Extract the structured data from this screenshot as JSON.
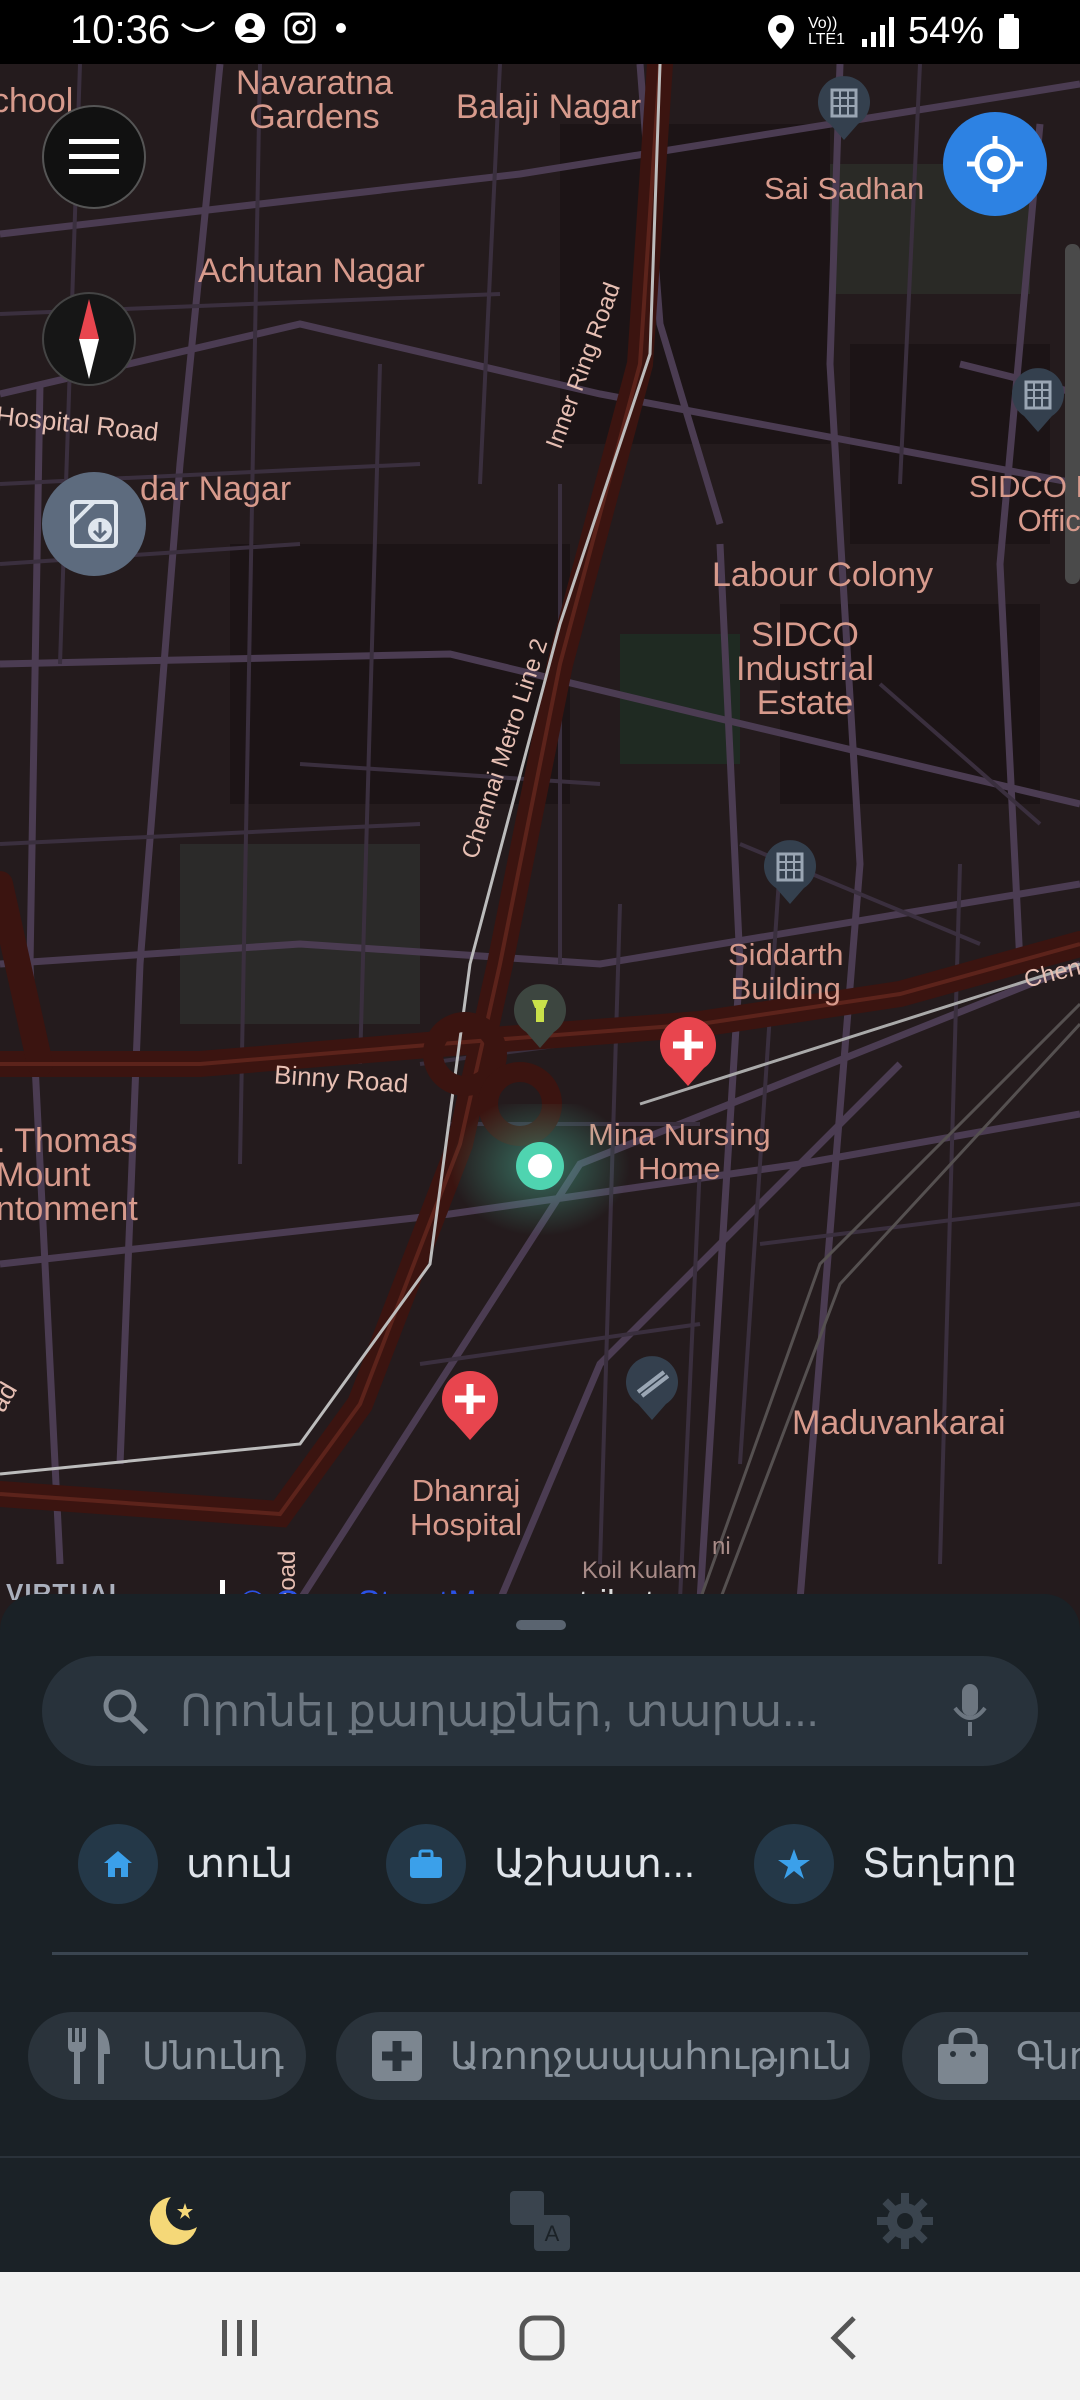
{
  "status_bar": {
    "time": "10:36",
    "battery": "54%",
    "network": "Vo)) LTE1"
  },
  "map": {
    "labels": {
      "school": "chool",
      "navaratna": "Navaratna\nGardens",
      "balaji": "Balaji Nagar",
      "sai_sadhan": "Sai Sadhan",
      "achutan": "Achutan Nagar",
      "hospital_road": "Hospital Road",
      "dar_nagar": "dar Nagar",
      "sidco_office": "SIDCO H\nOffice",
      "labour": "Labour Colony",
      "sidco_estate": "SIDCO\nIndustrial\nEstate",
      "inner_ring": "Inner Ring Road",
      "metro": "Chennai Metro Line 2",
      "siddarth": "Siddarth\nBuilding",
      "binny": "Binny Road",
      "mina": "Mina Nursing\nHome",
      "st_thomas": ". Thomas\nMount\nntonment",
      "maduvankarai": "Maduvankarai",
      "dhanraj": "Dhanraj\nHospital",
      "koil_kulam": "Koil Kulam",
      "ni": "ni",
      "chen": "Chen",
      "road_bottom": "Road",
      "left_bottom": "ad"
    },
    "attribution_link": "© OpenStreetMap",
    "attribution_rest": " contributors",
    "logo": "VIRTUAL\nMAZE"
  },
  "search": {
    "placeholder": "Որոնել քաղաքներ, տարա..."
  },
  "quick_actions": [
    {
      "label": "տուն",
      "icon": "home-icon"
    },
    {
      "label": "Աշխատ...",
      "icon": "briefcase-icon"
    },
    {
      "label": "Տեղերը",
      "icon": "star-icon"
    }
  ],
  "categories": [
    {
      "label": "Սնունդ",
      "icon": "cutlery-icon"
    },
    {
      "label": "Առողջապահություն",
      "icon": "medical-icon"
    },
    {
      "label": "Գնո",
      "icon": "shopping-bag-icon"
    }
  ],
  "toolbar": {
    "items": [
      "night-mode-icon",
      "translate-icon",
      "settings-icon"
    ]
  },
  "colors": {
    "accent_blue": "#2d82e3",
    "poi_red": "#e8454e",
    "location_teal": "#4fd4b0",
    "map_bg": "#241b1d",
    "sheet_bg": "#1a2126"
  }
}
